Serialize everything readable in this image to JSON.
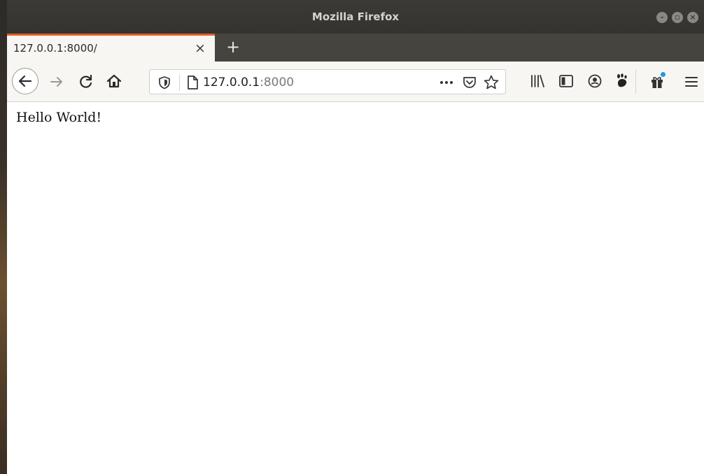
{
  "window": {
    "title": "Mozilla Firefox"
  },
  "tabs": [
    {
      "title": "127.0.0.1:8000/",
      "active": true
    }
  ],
  "address_bar": {
    "host": "127.0.0.1",
    "port": ":8000"
  },
  "page": {
    "text": "Hello World!"
  },
  "icons": {
    "window_controls": [
      "minimize-icon",
      "maximize-icon",
      "close-window-icon"
    ],
    "navigation": [
      "back-arrow-icon",
      "forward-arrow-icon",
      "reload-icon",
      "home-icon"
    ],
    "urlbar": [
      "tracking-shield-icon",
      "page-icon",
      "page-actions-icon",
      "pocket-icon",
      "bookmark-star-icon"
    ],
    "toolbar": [
      "library-icon",
      "sidebar-icon",
      "account-icon",
      "gnome-extension-icon",
      "addon-gift-icon",
      "hamburger-menu-icon"
    ]
  },
  "colors": {
    "active_tab_accent": "#e3602a",
    "titlebar": "#3b3a36",
    "tabstrip": "#45443f",
    "notification_dot": "#1e9ae6"
  }
}
